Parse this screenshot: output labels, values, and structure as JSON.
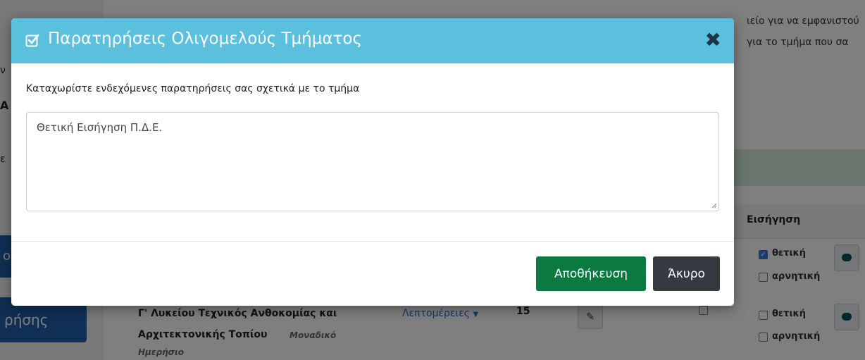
{
  "background": {
    "top_right_line1": "ιείο για να εμφανιστού",
    "top_right_line2": "για το τμήμα που σα",
    "side_frag_1": "ν",
    "side_frag_2": "Α",
    "side_frag_3": "ε",
    "side_button_a": "ο",
    "side_button_b": "ρήσης",
    "table_header_recommendation": "Εισήγηση",
    "row1": {
      "positive_label": "θετική",
      "negative_label": "αρνητική",
      "positive_checked": true
    },
    "row2": {
      "title_line1": "Γ' Λυκείου Τεχνικός Ανθοκομίας και",
      "title_line2": "Αρχιτεκτονικής Τοπίου",
      "badge_single": "Μοναδικό",
      "badge_type": "Ημερήσιο",
      "details_link": "Λεπτομέρειες",
      "count": "15",
      "positive_label": "θετική",
      "negative_label": "αρνητική"
    }
  },
  "modal": {
    "title": "Παρατηρήσεις Ολιγομελούς Τμήματος",
    "close_symbol": "✖",
    "prompt": "Καταχωρίστε ενδεχόμενες παρατηρήσεις σας σχετικά με το τμήμα",
    "textarea_value": "Θετική Εισήγηση Π.Δ.Ε.",
    "save_label": "Αποθήκευση",
    "cancel_label": "Άκυρο"
  },
  "colors": {
    "header": "#5bc0de",
    "save": "#0b7a41",
    "cancel": "#343a40"
  }
}
